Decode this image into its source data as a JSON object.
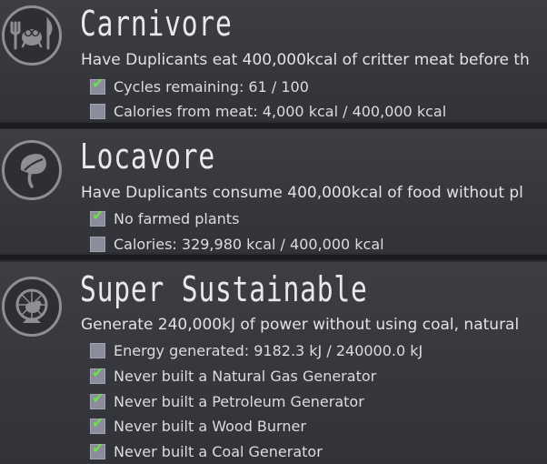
{
  "achievements": [
    {
      "title": "Carnivore",
      "icon": "fork-knife-critter-icon",
      "description": "Have Duplicants eat 400,000kcal of critter meat before th",
      "requirements": [
        {
          "label": "Cycles remaining: 61 / 100",
          "checked": true
        },
        {
          "label": "Calories from meat: 4,000 kcal / 400,000 kcal",
          "checked": false
        }
      ]
    },
    {
      "title": "Locavore",
      "icon": "leaf-sprout-icon",
      "description": "Have Duplicants consume 400,000kcal of food without pl",
      "requirements": [
        {
          "label": "No farmed plants",
          "checked": true
        },
        {
          "label": "Calories: 329,980 kcal / 400,000 kcal",
          "checked": false
        }
      ]
    },
    {
      "title": "Super Sustainable",
      "icon": "hamster-wheel-icon",
      "description": "Generate 240,000kJ of power without using coal, natural",
      "requirements": [
        {
          "label": "Energy generated: 9182.3 kJ / 240000.0 kJ",
          "checked": false
        },
        {
          "label": "Never built a Natural Gas Generator",
          "checked": true
        },
        {
          "label": "Never built a Petroleum Generator",
          "checked": true
        },
        {
          "label": "Never built a Wood Burner",
          "checked": true
        },
        {
          "label": "Never built a Coal Generator",
          "checked": true
        }
      ]
    }
  ],
  "colors": {
    "check": "#6de04a",
    "panel": "#3a3b40",
    "separator": "#1b1c1f"
  }
}
